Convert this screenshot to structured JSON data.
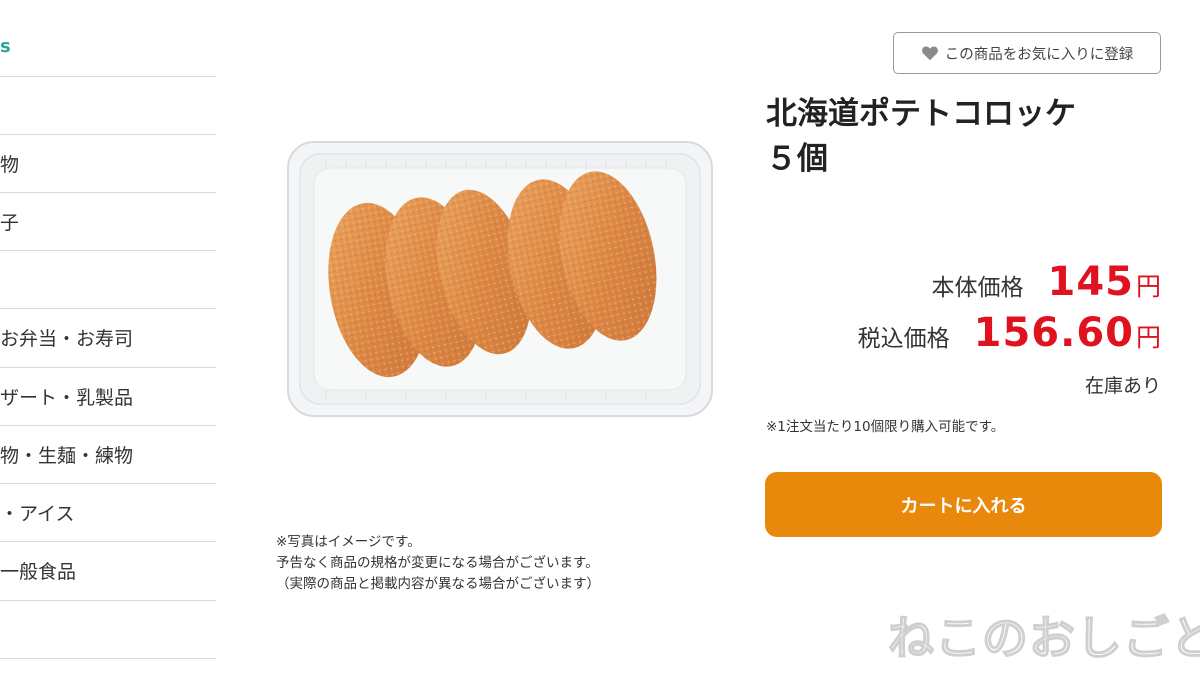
{
  "sidebar": {
    "top_fragment": "s",
    "items": [
      {
        "label": ""
      },
      {
        "label": "物"
      },
      {
        "label": "子"
      },
      {
        "label": ""
      },
      {
        "label": "お弁当・お寿司"
      },
      {
        "label": "ザート・乳製品"
      },
      {
        "label": "物・生麺・練物"
      },
      {
        "label": "・アイス"
      },
      {
        "label": "一般食品"
      },
      {
        "label": ""
      }
    ]
  },
  "product": {
    "image_alt": "北海道ポテトコロッケ ５個",
    "disclaimer": [
      "※写真はイメージです。",
      "予告なく商品の規格が変更になる場合がございます。",
      "（実際の商品と掲載内容が異なる場合がございます）"
    ],
    "favorite_label": "この商品をお気に入りに登録",
    "title_line1": "北海道ポテトコロッケ",
    "title_line2": "５個",
    "base_price_label": "本体価格",
    "base_price": "145",
    "tax_price_label": "税込価格",
    "tax_price": "156.60",
    "currency": "円",
    "stock": "在庫あり",
    "limit_note": "※1注文当たり10個限り購入可能です。",
    "cart_label": "カートに入れる"
  },
  "watermark": "ねこのおしごと",
  "colors": {
    "price": "#e0121f",
    "cart_button": "#e8890c",
    "divider": "#d9d9d9"
  },
  "icons": {
    "favorite": "heart-icon"
  }
}
